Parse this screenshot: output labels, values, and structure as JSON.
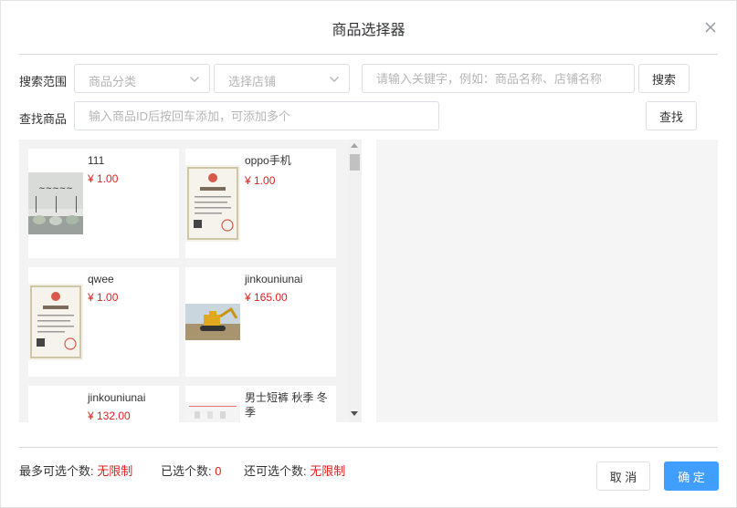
{
  "dialog": {
    "title": "商品选择器"
  },
  "search": {
    "scope_label": "搜索范围",
    "category_placeholder": "商品分类",
    "store_placeholder": "选择店铺",
    "keyword_placeholder": "请输入关键字，例如：商品名称、店铺名称",
    "search_button": "搜索",
    "find_label": "查找商品",
    "id_placeholder": "输入商品ID后按回车添加，可添加多个",
    "find_button": "查找"
  },
  "products": [
    {
      "name": "111",
      "price": "¥ 1.00",
      "thumb": "tea-set-image"
    },
    {
      "name": "oppo手机",
      "price": "¥ 1.00",
      "thumb": "business-license-image"
    },
    {
      "name": "qwee",
      "price": "¥ 1.00",
      "thumb": "business-license-image"
    },
    {
      "name": "jinkouniunai",
      "price": "¥ 165.00",
      "thumb": "excavator-image"
    },
    {
      "name": "jinkouniunai",
      "price": "¥ 132.00",
      "thumb": ""
    },
    {
      "name": "男士短裤 秋季 冬季",
      "price": "",
      "thumb": "product-image"
    }
  ],
  "footer": {
    "max_label": "最多可选个数:",
    "max_value": "无限制",
    "selected_label": "已选个数:",
    "selected_value": "0",
    "remaining_label": "还可选个数:",
    "remaining_value": "无限制",
    "cancel_button": "取 消",
    "confirm_button": "确 定"
  },
  "colors": {
    "primary": "#409eff",
    "price": "#e02020"
  }
}
